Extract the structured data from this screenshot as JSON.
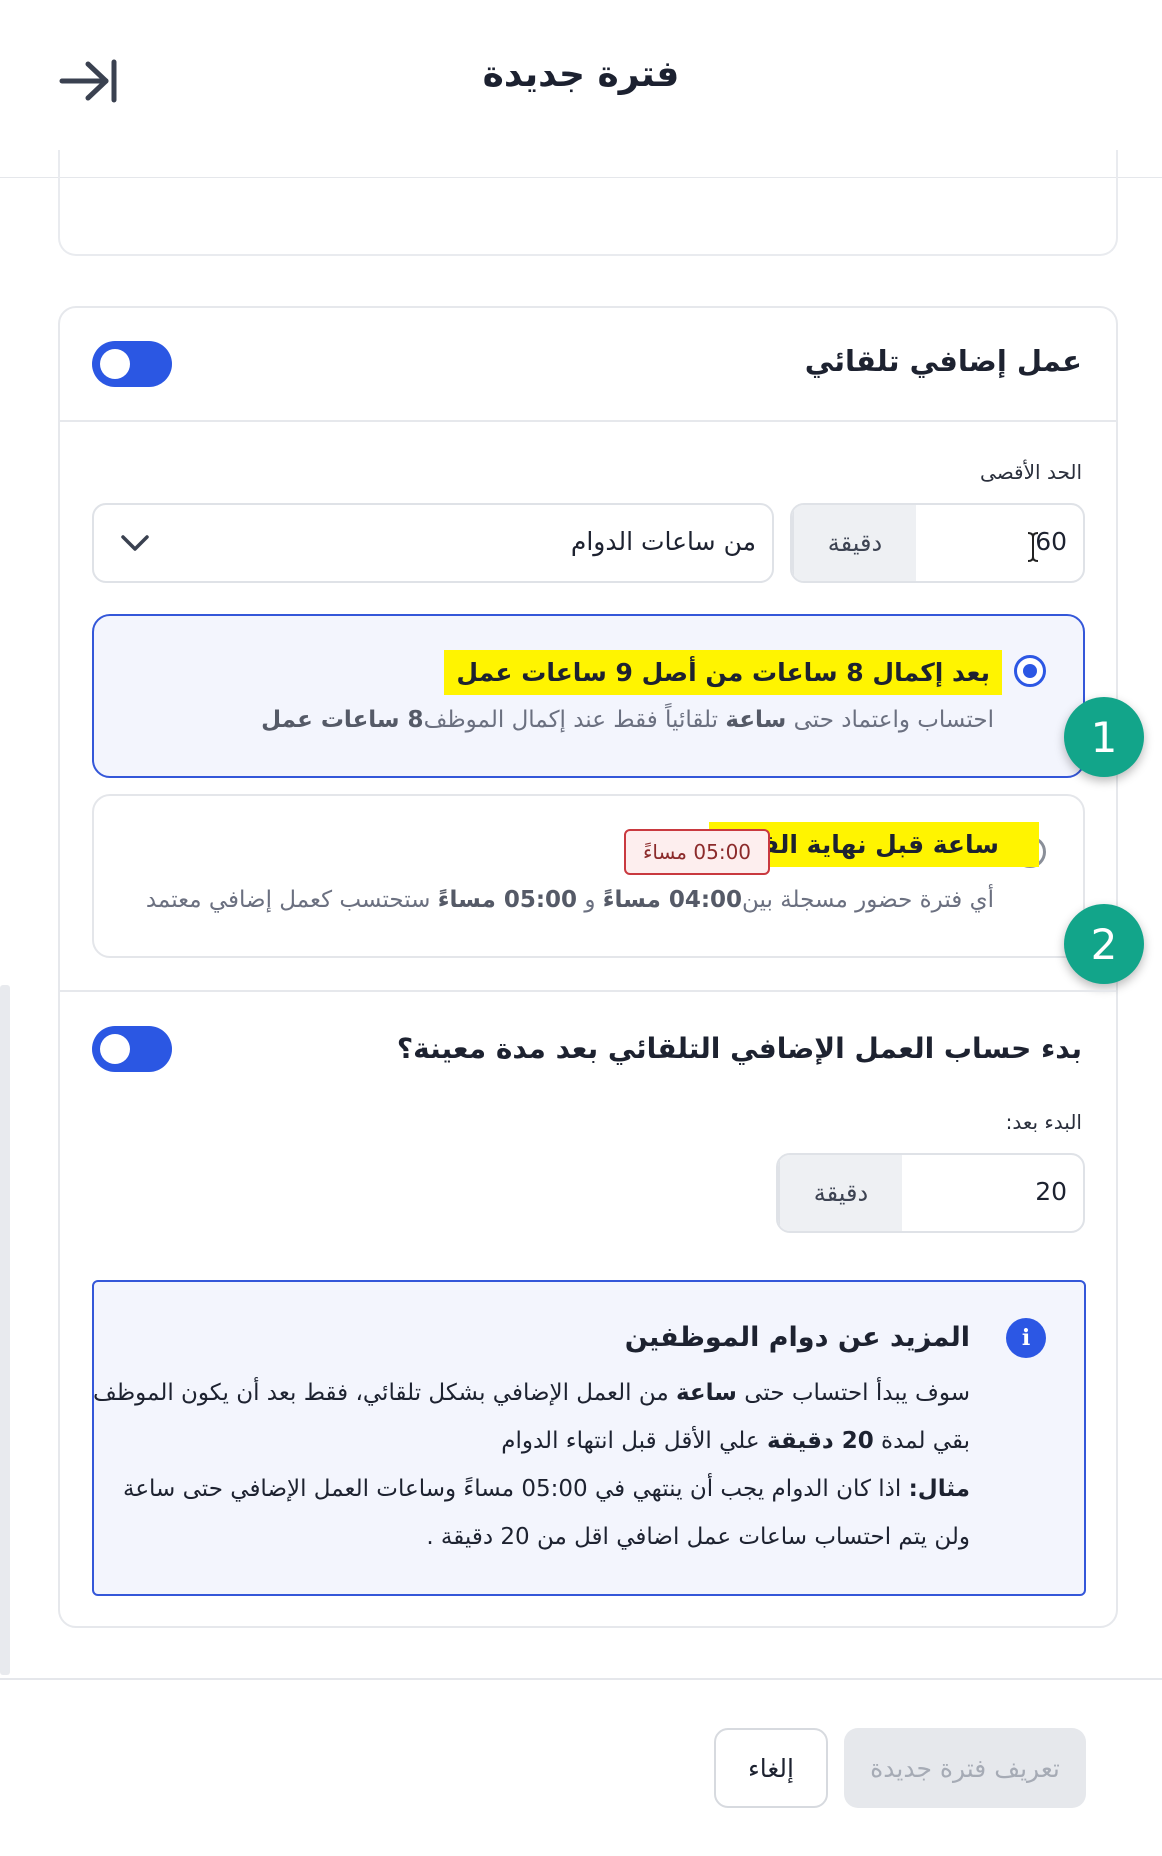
{
  "header": {
    "title": "فترة جديدة",
    "collapse_icon": "collapse-right-arrow-icon"
  },
  "auto_overtime": {
    "title": "عمل إضافي تلقائي",
    "enabled": true,
    "max_label": "الحد الأقصى",
    "max_value": "60",
    "max_unit": "دقيقة",
    "basis_select": "من ساعات الدوام",
    "option_1": {
      "selected": true,
      "title": "بعد إكمال 8 ساعات من أصل 9 ساعات عمل",
      "desc_part1": "احتساب واعتماد حتى ",
      "desc_bold1": "ساعة",
      "desc_part2": " تلقائياً فقط عند إكمال الموظف",
      "desc_bold2": "8 ساعات عمل"
    },
    "option_2": {
      "selected": false,
      "title": "ساعة قبل نهاية الفترة",
      "badge": "05:00 مساءً",
      "desc_part1": "أي فترة حضور مسجلة بين",
      "desc_bold1": "04:00 مساءً",
      "desc_part2": " و ",
      "desc_bold2": "05:00 مساءً",
      "desc_part3": " ستحتسب كعمل إضافي معتمد"
    },
    "step_1": "1",
    "step_2": "2"
  },
  "delay_start": {
    "title": "بدء حساب العمل الإضافي التلقائي بعد مدة معينة؟",
    "enabled": true,
    "start_label": "البدء بعد:",
    "start_value": "20",
    "start_unit": "دقيقة"
  },
  "info": {
    "title": "المزيد عن دوام الموظفين",
    "icon": "info-icon",
    "l1_a": "سوف يبدأ احتساب حتى ",
    "l1_b": "ساعة",
    "l1_c": " من العمل الإضافي بشكل تلقائي، فقط بعد أن يكون الموظف",
    "l2_a": "بقي لمدة ",
    "l2_b": "20 دقيقة",
    "l2_c": " علي الأقل قبل انتهاء الدوام",
    "l3_a": "مثال:",
    "l3_b": " اذا كان الدوام يجب أن ينتهي في 05:00 مساءً وساعات العمل الإضافي حتى ساعة",
    "l4": "ولن يتم احتساب ساعات عمل اضافي اقل من 20 دقيقة ."
  },
  "footer": {
    "cancel": "إلغاء",
    "submit": "تعريف فترة جديدة"
  },
  "colors": {
    "accent": "#2b57e3",
    "highlight": "#fff400",
    "step_badge": "#12a58a"
  }
}
